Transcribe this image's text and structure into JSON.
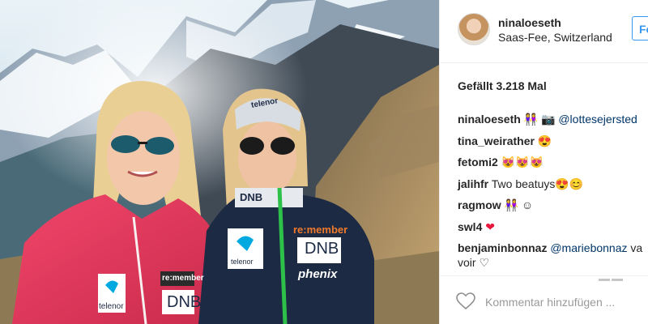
{
  "post": {
    "username": "ninaloeseth",
    "location": "Saas-Fee, Switzerland",
    "follow_label": "Fo",
    "likes_text": "Gefällt 3.218 Mal"
  },
  "photo": {
    "subject_left": {
      "jacket_brand_top": "re:member",
      "jacket_brand_mid": "DNB",
      "jacket_sponsor": "telenor"
    },
    "subject_right": {
      "headband_text": "telenor",
      "collar_text": "DNB",
      "jacket_sponsor": "telenor",
      "jacket_brand_top": "re:member",
      "jacket_brand_mid": "DNB",
      "jacket_brand_bottom": "phenix"
    }
  },
  "comments": [
    {
      "user": "ninaloeseth",
      "emojis": "👭 📷",
      "mention": "@lottesejersted",
      "text": ""
    },
    {
      "user": "tina_weirather",
      "emojis": "😍",
      "mention": "",
      "text": ""
    },
    {
      "user": "fetomi2",
      "emojis": "😻😻😻",
      "mention": "",
      "text": ""
    },
    {
      "user": "jalihfr",
      "emojis": "😍😊",
      "mention": "",
      "text": "Two beatuys"
    },
    {
      "user": "ragmow",
      "emojis": "👭 ☺",
      "mention": "",
      "text": ""
    },
    {
      "user": "swl4",
      "emojis": "❤",
      "mention": "",
      "text": ""
    },
    {
      "user": "benjaminbonnaz",
      "emojis": "",
      "mention": "@mariebonnaz",
      "text": "va voir ♡"
    }
  ],
  "footer": {
    "comment_placeholder": "Kommentar hinzufügen ..."
  },
  "colors": {
    "accent": "#3897f0",
    "mention": "#003569",
    "jacket_pink": "#e8365a",
    "jacket_navy": "#1d2a44",
    "jacket_green": "#2ec14a"
  },
  "icons": {
    "like": "heart-outline-icon"
  }
}
